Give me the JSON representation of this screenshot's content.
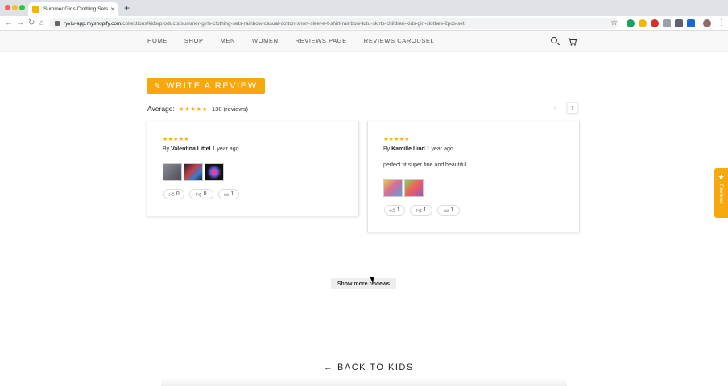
{
  "browser": {
    "tab_title": "Summer Girls Clothing Sets Ra",
    "tab_close": "×",
    "new_tab": "+",
    "url_host": "ryviu-app.myshopify.com",
    "url_path": "/collections/kids/products/summer-girls-clothing-sets-rainbow-casual-cotton-short-sleeve-t-shirt-rainbow-tutu-skirts-children-kids-girl-clothes-2pcs-set"
  },
  "nav": {
    "items": [
      "HOME",
      "SHOP",
      "MEN",
      "WOMEN",
      "REVIEWS PAGE",
      "REVIEWS CAROUSEL"
    ]
  },
  "reviews": {
    "write_label": "WRITE A REVIEW",
    "average_label": "Average:",
    "average_stars": "★★★★★",
    "count_label": "130 (reviews)",
    "prev_arrow": "‹",
    "next_arrow": "›",
    "cards": [
      {
        "stars": "★★★★★",
        "by": "By",
        "author": "Valentina Littel",
        "time": "1 year ago",
        "body": "",
        "likes": "0",
        "dislikes": "0",
        "comments": "1"
      },
      {
        "stars": "★★★★★",
        "by": "By",
        "author": "Kamille Lind",
        "time": "1 year ago",
        "body": "perfect fit super fine and beautiful",
        "likes": "1",
        "dislikes": "1",
        "comments": "1"
      }
    ],
    "show_more": "Show more reviews"
  },
  "back_link": "← BACK TO KIDS",
  "side_tab": {
    "star": "★",
    "label": "Reviews"
  },
  "colors": {
    "accent": "#f6a80f"
  }
}
